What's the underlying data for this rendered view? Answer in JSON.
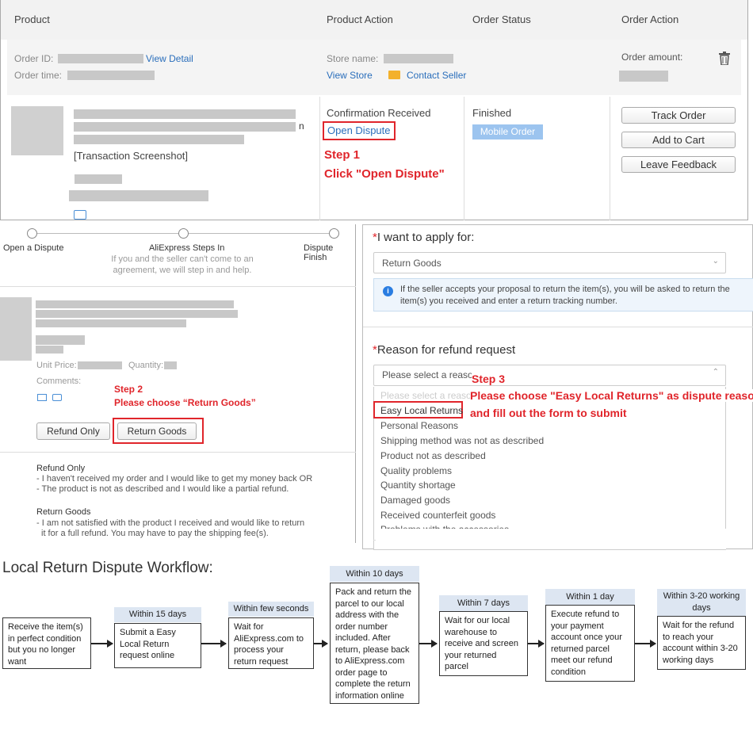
{
  "panel1": {
    "headers": [
      "Product",
      "Product Action",
      "Order Status",
      "Order Action"
    ],
    "order_id_label": "Order ID:",
    "view_detail": "View Detail",
    "order_time_label": "Order time:",
    "store_name_label": "Store name:",
    "view_store": "View Store",
    "contact_seller": "Contact Seller",
    "order_amount_label": "Order amount:",
    "product_partial_text": "n",
    "transaction_screenshot": "[Transaction Screenshot]",
    "confirmation_received": "Confirmation Received",
    "open_dispute": "Open Dispute",
    "step1_title": "Step 1",
    "step1_text": "Click \"Open Dispute\"",
    "status_finished": "Finished",
    "mobile_order": "Mobile Order",
    "track_order": "Track Order",
    "add_to_cart": "Add to Cart",
    "leave_feedback": "Leave Feedback"
  },
  "panel2": {
    "steps": [
      "Open a Dispute",
      "AliExpress Steps In",
      "Dispute Finish"
    ],
    "steps_sub": "If you and the seller can't come to an agreement, we will step in and help.",
    "unit_price_label": "Unit Price:",
    "quantity_label": "Quantity:",
    "comments_label": "Comments:",
    "step2_title": "Step 2",
    "step2_text": "Please choose “Return Goods”",
    "refund_only_btn": "Refund Only",
    "return_goods_btn": "Return Goods",
    "refund_only_title": "Refund Only",
    "refund_only_l1": "- I haven't received my order and I would like to get my money back OR",
    "refund_only_l2": "- The product is not as described and I would like a partial refund.",
    "return_goods_title": "Return Goods",
    "return_goods_l1": "- I am not satisfied with the product I received and would like to return",
    "return_goods_l2": "it for a full refund. You may have to pay the shipping fee(s)."
  },
  "panel3": {
    "apply_label": "I want to apply for:",
    "apply_value": "Return Goods",
    "info_text": "If the seller accepts your proposal to return the item(s), you will be asked to return the item(s) you received and enter a return tracking number.",
    "reason_label": "Reason for refund request",
    "reason_placeholder": "Please select a reason",
    "reason_placeholder_faded": "Please select a reason",
    "step3_title": "Step 3",
    "step3_l1": "Please choose \"Easy Local Returns\" as dispute reason",
    "step3_l2": "and fill out the form to submit",
    "options": [
      "Easy Local Returns",
      "Personal Reasons",
      "Shipping method was not as described",
      "Product not as described",
      "Quality problems",
      "Quantity shortage",
      "Damaged goods",
      "Received counterfeit goods",
      "Problems with the accessories"
    ],
    "asterisk": "*"
  },
  "workflow": {
    "title": "Local Return Dispute Workflow:",
    "steps": [
      {
        "label": "",
        "text": "Receive the item(s) in perfect condition but you no longer want"
      },
      {
        "label": "Within 15 days",
        "text": "Submit a Easy Local Return request online"
      },
      {
        "label": "Within few seconds",
        "text": "Wait for AliExpress.com to process your return request"
      },
      {
        "label": "Within 10 days",
        "text": "Pack and return the parcel to our local address with the order number included. After return, please back to AliExpress.com order page to complete the return information online"
      },
      {
        "label": "Within 7 days",
        "text": "Wait for our local warehouse to receive and screen your returned parcel"
      },
      {
        "label": "Within 1 day",
        "text": "Execute refund to your payment account once your returned parcel meet our refund condition"
      },
      {
        "label": "Within 3-20 working days",
        "text": "Wait for the refund to reach your account within 3-20 working days"
      }
    ]
  }
}
